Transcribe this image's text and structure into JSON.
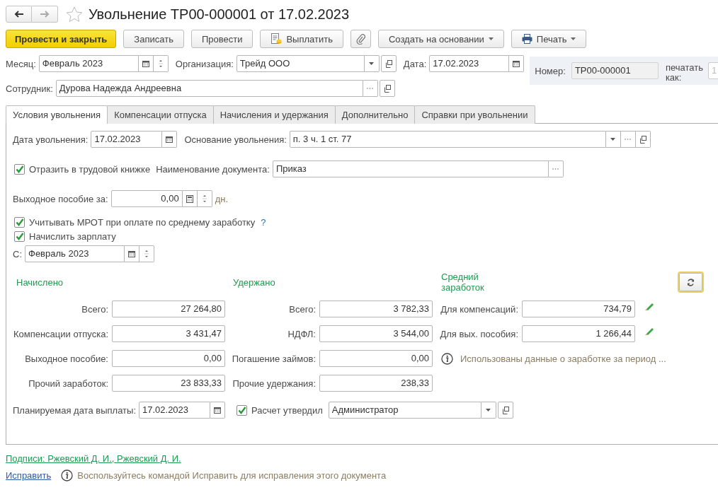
{
  "window": {
    "title": "Увольнение ТР00-000001 от 17.02.2023"
  },
  "toolbar": [
    {
      "kind": "primary",
      "label": "Провести и закрыть"
    },
    {
      "kind": "plain",
      "label": "Записать"
    },
    {
      "kind": "plain",
      "label": "Провести"
    },
    {
      "kind": "pay",
      "label": "Выплатить"
    },
    {
      "kind": "attach"
    },
    {
      "kind": "menu",
      "label": "Создать на основании"
    },
    {
      "kind": "print",
      "label": "Печать"
    }
  ],
  "header": {
    "month": {
      "label": "Месяц:",
      "value": "Февраль 2023"
    },
    "organization": {
      "label": "Организация:",
      "value": "Трейд ООО"
    },
    "date": {
      "label": "Дата:",
      "value": "17.02.2023"
    },
    "number": {
      "label": "Номер:",
      "value": "ТР00-000001"
    },
    "print_as": {
      "label": "печатать как:",
      "value": "1"
    },
    "employee": {
      "label": "Сотрудник:",
      "value": "Дурова Надежда Андреевна"
    }
  },
  "tabs": [
    {
      "label": "Условия увольнения",
      "selected": true
    },
    {
      "label": "Компенсации отпуска",
      "selected": false
    },
    {
      "label": "Начисления и удержания",
      "selected": false
    },
    {
      "label": "Дополнительно",
      "selected": false
    },
    {
      "label": "Справки при увольнении",
      "selected": false
    }
  ],
  "conditions": {
    "dismissal_date": {
      "label": "Дата увольнения:",
      "value": "17.02.2023"
    },
    "basis": {
      "label": "Основание увольнения:",
      "value": "п. 3 ч. 1 ст. 77"
    },
    "work_book": {
      "label": "Отразить в трудовой книжке",
      "checked": true
    },
    "document_name": {
      "label": "Наименование документа:",
      "value": "Приказ"
    },
    "severance_days": {
      "label": "Выходное пособие за:",
      "value": "0,00",
      "unit": "дн."
    },
    "mrot": {
      "label": "Учитывать МРОТ при оплате по среднему заработку",
      "checked": true,
      "help": "?"
    },
    "accrue_salary": {
      "label": "Начислить зарплату",
      "checked": true
    },
    "from_month": {
      "label": "С:",
      "value": "Февраль 2023"
    }
  },
  "accrued": {
    "title": "Начислено",
    "rows": [
      {
        "label": "Всего:",
        "value": "27 264,80"
      },
      {
        "label": "Компенсации отпуска:",
        "value": "3 431,47"
      },
      {
        "label": "Выходное пособие:",
        "value": "0,00"
      },
      {
        "label": "Прочий заработок:",
        "value": "23 833,33"
      }
    ]
  },
  "withheld": {
    "title": "Удержано",
    "rows": [
      {
        "label": "Всего:",
        "value": "3 782,33"
      },
      {
        "label": "НДФЛ:",
        "value": "3 544,00"
      },
      {
        "label": "Погашение займов:",
        "value": "0,00"
      },
      {
        "label": "Прочие удержания:",
        "value": "238,33"
      }
    ]
  },
  "average": {
    "title": "Средний заработок",
    "rows": [
      {
        "label": "Для компенсаций:",
        "value": "734,79"
      },
      {
        "label": "Для вых. пособия:",
        "value": "1 266,44"
      }
    ],
    "info": "Использованы данные о заработке за период ..."
  },
  "payment_date": {
    "label": "Планируемая дата выплаты:",
    "value": "17.02.2023"
  },
  "approved": {
    "label": "Расчет утвердил",
    "checked": true,
    "value": "Администратор"
  },
  "footer": {
    "signatures": "Подписи: Ржевский Д. И., Ржевский Д. И.",
    "fix_link": "Исправить",
    "fix_hint": "Воспользуйтесь командой Исправить для исправления этого документа"
  }
}
